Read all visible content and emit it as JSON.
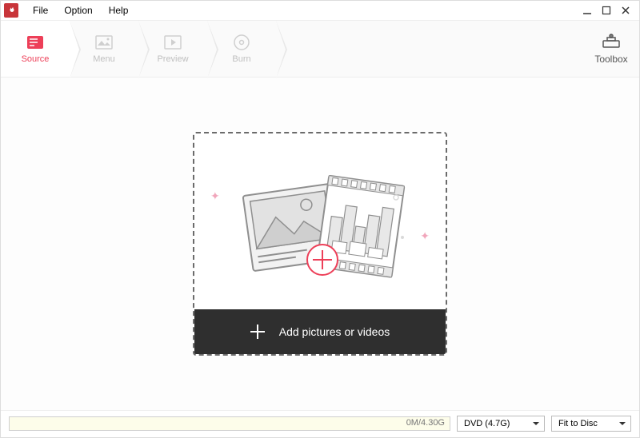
{
  "menubar": {
    "items": [
      "File",
      "Option",
      "Help"
    ]
  },
  "steps": [
    {
      "label": "Source",
      "icon": "source-icon",
      "active": true
    },
    {
      "label": "Menu",
      "icon": "menu-icon",
      "active": false
    },
    {
      "label": "Preview",
      "icon": "preview-icon",
      "active": false
    },
    {
      "label": "Burn",
      "icon": "burn-icon",
      "active": false
    }
  ],
  "toolbox": {
    "label": "Toolbox"
  },
  "dropzone": {
    "add_label": "Add pictures or videos"
  },
  "statusbar": {
    "progress_text": "0M/4.30G",
    "disc_type": {
      "selected": "DVD (4.7G)"
    },
    "fit": {
      "selected": "Fit to Disc"
    }
  },
  "colors": {
    "accent": "#ed3f58",
    "logo_bg": "#c8353a"
  }
}
